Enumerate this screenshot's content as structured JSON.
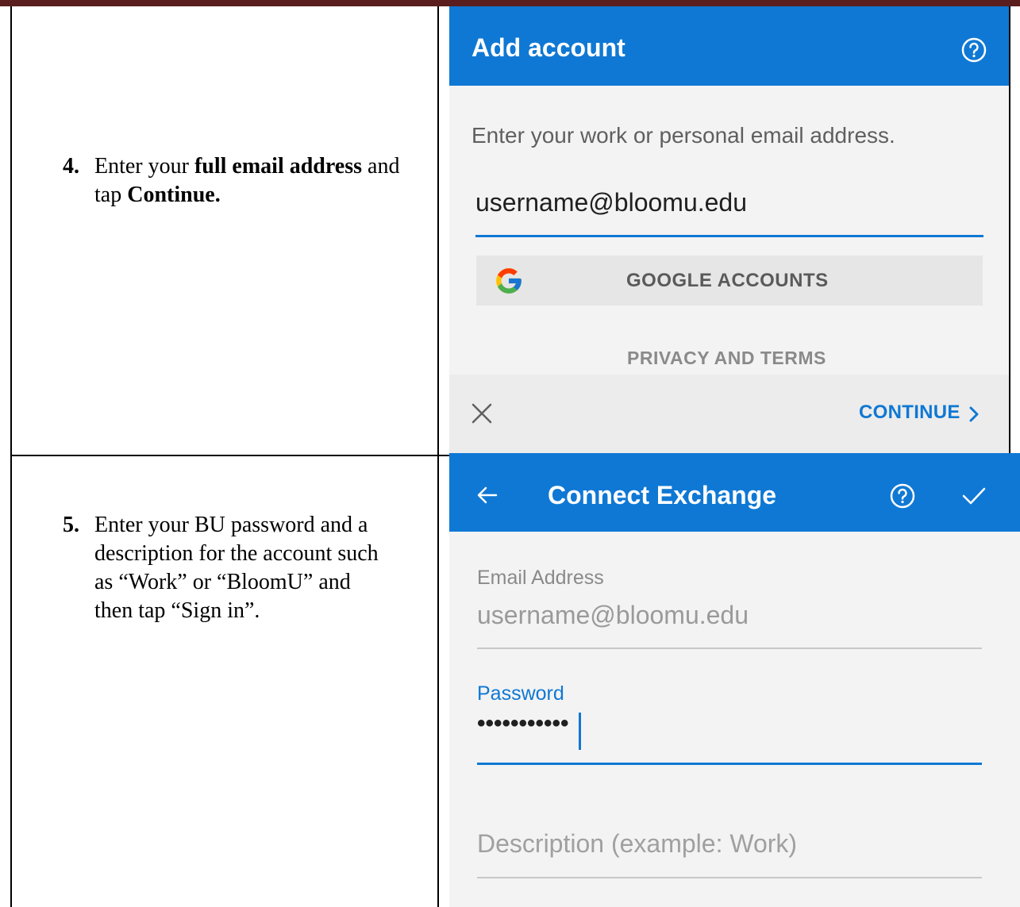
{
  "step4": {
    "number": "4.",
    "parts": [
      "Enter your ",
      "full email address",
      " and tap ",
      "Continue."
    ]
  },
  "step5": {
    "number": "5.",
    "lines": [
      "Enter your BU password and a",
      "description for the account such",
      "as “Work” or “BloomU” and",
      "then tap “Sign in”."
    ]
  },
  "add_account": {
    "title": "Add account",
    "prompt": "Enter your work or personal email address.",
    "email_value": "username@bloomu.edu",
    "google_button": "GOOGLE ACCOUNTS",
    "privacy_link": "PRIVACY AND TERMS",
    "continue_button": "CONTINUE"
  },
  "connect_exchange": {
    "title": "Connect Exchange",
    "email_label": "Email Address",
    "email_value": "username@bloomu.edu",
    "password_label": "Password",
    "password_mask": "•••••••••••",
    "description_placeholder": "Description (example: Work)"
  },
  "icons": [
    "help-icon",
    "close-icon",
    "chevron-right-icon",
    "back-arrow-icon",
    "check-icon",
    "google-logo-icon"
  ],
  "colors": {
    "accent": "#0f78d4",
    "topbar": "#5a1e1e"
  }
}
